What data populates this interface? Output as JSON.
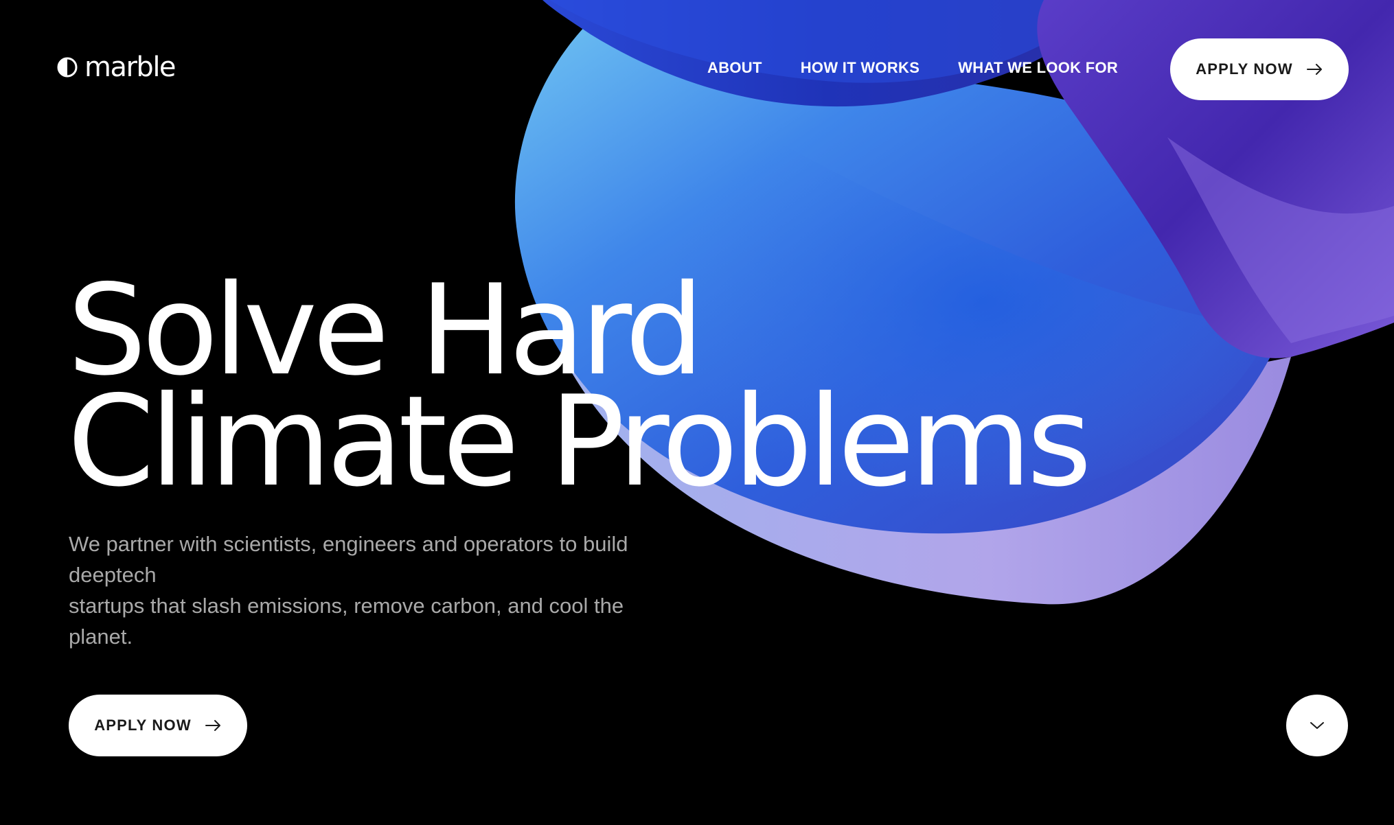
{
  "brand": {
    "name": "marble",
    "logo_icon": "half-circle-icon"
  },
  "nav": {
    "items": [
      {
        "label": "ABOUT"
      },
      {
        "label": "HOW IT WORKS"
      },
      {
        "label": "WHAT WE LOOK FOR"
      }
    ]
  },
  "header": {
    "cta_label": "APPLY NOW",
    "cta_icon": "arrow-right-icon"
  },
  "hero": {
    "headline_lines": [
      "Solve Hard",
      "Climate Problems"
    ],
    "subcopy_lines": [
      "We partner with scientists, engineers and operators to build deeptech",
      "startups that slash emissions, remove carbon, and cool the planet."
    ],
    "cta_label": "APPLY NOW",
    "cta_icon": "arrow-right-icon",
    "scroll_icon": "chevron-down-icon"
  },
  "colors": {
    "background": "#000000",
    "text": "#ffffff",
    "subcopy": "#a9a9a9",
    "button_bg": "#ffffff",
    "button_text": "#1a1a1a",
    "art_blue": "#2f6be6",
    "art_light_blue": "#5fb0ee",
    "art_lavender": "#b6a6ec",
    "art_purple": "#4b2fb0"
  }
}
